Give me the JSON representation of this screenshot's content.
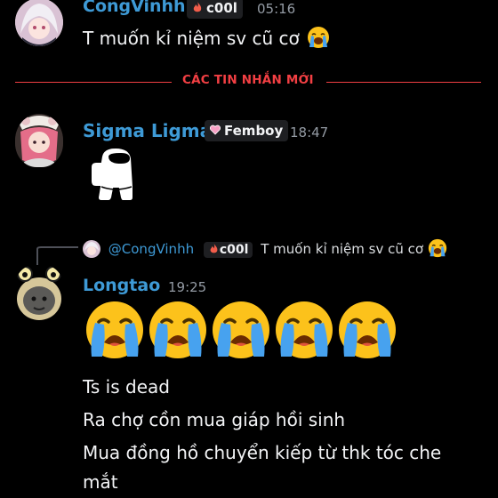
{
  "messages": [
    {
      "author": "CongVinhh",
      "author_color": "#3e9ad6",
      "badge": "c00l",
      "badge_icon": "fire-icon",
      "time": "05:16",
      "text": "T muốn kỉ niệm sv cũ cơ",
      "text_emoji": "loudly-crying-face"
    },
    {
      "author": "Sigma Ligma",
      "author_color": "#3e9ad6",
      "badge": "Femboy",
      "badge_icon": "pink-heart-icon",
      "time": "18:47",
      "attachment": "among-us-crewmate-sticker"
    },
    {
      "reply": {
        "author": "@CongVinhh",
        "badge": "c00l",
        "text": "T muốn kỉ niệm sv cũ cơ"
      },
      "author": "Longtao",
      "author_color": "#3e9ad6",
      "time": "19:25",
      "emoji_count": 5,
      "emoji": "loudly-crying-face",
      "lines": [
        "Ts is dead",
        "Ra chợ cồn mua giáp hồi sinh",
        "Mua đồng hồ chuyển kiếp từ  thk tóc che",
        "mắt"
      ]
    }
  ],
  "divider": {
    "label": "CÁC TIN NHẮN MỚI",
    "color": "#f23f43"
  },
  "colors": {
    "background": "#000000",
    "link": "#3e9ad6",
    "muted": "#949ba4",
    "badge_bg": "#1e1f22"
  }
}
